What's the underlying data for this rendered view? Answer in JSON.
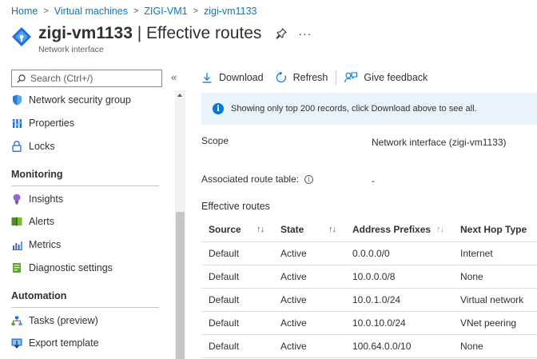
{
  "breadcrumb": [
    "Home",
    "Virtual machines",
    "ZIGI-VM1",
    "zigi-vm1133"
  ],
  "header": {
    "name": "zigi-vm1133",
    "title_rest": " | Effective routes",
    "subtitle": "Network interface",
    "more": "···"
  },
  "sidebar": {
    "search_placeholder": "Search (Ctrl+/)",
    "collapse": "«",
    "items_top": [
      {
        "label": "Network security group",
        "icon": "shield-icon"
      },
      {
        "label": "Properties",
        "icon": "properties-icon"
      },
      {
        "label": "Locks",
        "icon": "lock-icon"
      }
    ],
    "monitoring_title": "Monitoring",
    "monitoring_items": [
      {
        "label": "Insights",
        "icon": "lightbulb-icon"
      },
      {
        "label": "Alerts",
        "icon": "alerts-icon"
      },
      {
        "label": "Metrics",
        "icon": "metrics-icon"
      },
      {
        "label": "Diagnostic settings",
        "icon": "diagnostic-settings-icon"
      }
    ],
    "automation_title": "Automation",
    "automation_items": [
      {
        "label": "Tasks (preview)",
        "icon": "tasks-icon"
      },
      {
        "label": "Export template",
        "icon": "export-template-icon"
      }
    ]
  },
  "toolbar": {
    "download": "Download",
    "refresh": "Refresh",
    "feedback": "Give feedback"
  },
  "info_banner": "Showing only top 200 records, click Download above to see all.",
  "scope": {
    "label": "Scope",
    "value": "Network interface (zigi-vm1133)"
  },
  "route_table": {
    "label": "Associated route table:",
    "value": "-"
  },
  "effective_routes": {
    "title": "Effective routes",
    "columns": [
      "Source",
      "State",
      "Address Prefixes",
      "Next Hop Type"
    ],
    "rows": [
      [
        "Default",
        "Active",
        "0.0.0.0/0",
        "Internet"
      ],
      [
        "Default",
        "Active",
        "10.0.0.0/8",
        "None"
      ],
      [
        "Default",
        "Active",
        "10.0.1.0/24",
        "Virtual network"
      ],
      [
        "Default",
        "Active",
        "10.0.10.0/24",
        "VNet peering"
      ],
      [
        "Default",
        "Active",
        "100.64.0.0/10",
        "None"
      ]
    ]
  },
  "colors": {
    "accent": "#0078d4",
    "banner_bg": "#ebf3fc"
  }
}
